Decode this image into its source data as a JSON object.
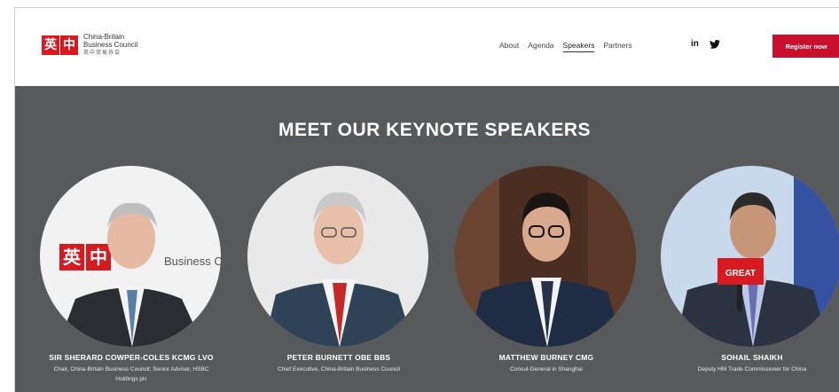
{
  "brand": {
    "logo_chars": [
      "英",
      "中"
    ],
    "line1": "China-Britain",
    "line2": "Business Council",
    "line3": "英中贸易协会",
    "color": "#d71920"
  },
  "nav": {
    "items": [
      {
        "label": "About",
        "active": false
      },
      {
        "label": "Agenda",
        "active": false
      },
      {
        "label": "Speakers",
        "active": true
      },
      {
        "label": "Partners",
        "active": false
      }
    ]
  },
  "social": {
    "linkedin_label": "in",
    "twitter_icon": "twitter-icon"
  },
  "register_label": "Register now",
  "accent_color": "#c8102e",
  "section": {
    "title": "MEET OUR KEYNOTE SPEAKERS",
    "background": "#58595b"
  },
  "speakers": [
    {
      "name": "SIR SHERARD COWPER-COLES KCMG LVO",
      "role": "Chair, China-Britain Business Council; Senior Adviser, HSBC Holdings plc",
      "photo_bg": "#f2f2f2",
      "photo_text": "Business Council"
    },
    {
      "name": "PETER BURNETT OBE BBS",
      "role": "Chief Executive, China-Britain Business Council",
      "photo_bg": "#e9e9e9"
    },
    {
      "name": "MATTHEW BURNEY CMG",
      "role": "Consul-General in Shanghai",
      "photo_bg": "#4a2e22"
    },
    {
      "name": "SOHAIL SHAIKH",
      "role": "Deputy HM Trade Commissioner for China",
      "photo_bg": "#c9d9ec",
      "sign_text": "GREAT"
    }
  ]
}
